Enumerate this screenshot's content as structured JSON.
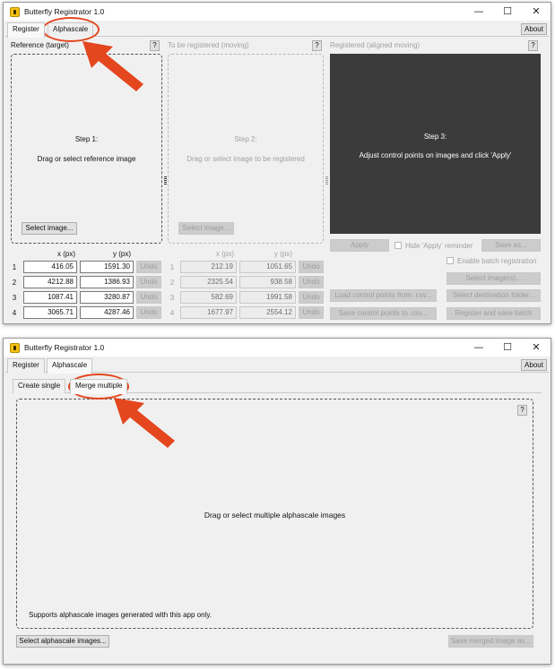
{
  "app": {
    "title": "Butterfly Registrator 1.0"
  },
  "window_controls": {
    "minimize": "—",
    "maximize": "☐",
    "close": "✕"
  },
  "tabs": {
    "register": "Register",
    "alphascale": "Alphascale",
    "about": "About"
  },
  "register": {
    "help": "?",
    "reference": {
      "header": "Reference (target)",
      "step": "Step 1:",
      "instruction": "Drag or select reference image",
      "select_button": "Select image..."
    },
    "moving": {
      "header": "To be registered (moving)",
      "step": "Step 2:",
      "instruction": "Drag or select image to be registered",
      "select_button": "Select image..."
    },
    "registered": {
      "header": "Registered (aligned moving)",
      "step": "Step 3:",
      "instruction": "Adjust control points on images and click 'Apply'"
    },
    "col_x": "x (px)",
    "col_y": "y (px)",
    "undo_label": "Undo",
    "ref_points": [
      {
        "n": "1",
        "x": "416.05",
        "y": "1591.30"
      },
      {
        "n": "2",
        "x": "4212.88",
        "y": "1386.93"
      },
      {
        "n": "3",
        "x": "1087.41",
        "y": "3280.87"
      },
      {
        "n": "4",
        "x": "3065.71",
        "y": "4287.46"
      }
    ],
    "mov_points": [
      {
        "n": "1",
        "x": "212.19",
        "y": "1051.65"
      },
      {
        "n": "2",
        "x": "2325.54",
        "y": "938.58"
      },
      {
        "n": "3",
        "x": "582.69",
        "y": "1991.58"
      },
      {
        "n": "4",
        "x": "1677.97",
        "y": "2554.12"
      }
    ],
    "apply": "Apply",
    "hide_apply": "Hide 'Apply' reminder",
    "save_as": "Save as...",
    "enable_batch": "Enable batch registration",
    "select_images": "Select image(s)...",
    "load_cp": "Load control points from .csv...",
    "select_dest": "Select destination folder...",
    "save_cp": "Save control points to .csv...",
    "register_batch": "Register and save batch"
  },
  "alphascale": {
    "subtabs": {
      "create_single": "Create single",
      "merge_multiple": "Merge multiple"
    },
    "help": "?",
    "drop_text": "Drag or select multiple alphascale images",
    "note": "Supports alphascale images generated with this app only.",
    "select_button": "Select alphascale images...",
    "save_button": "Save merged image as..."
  },
  "colors": {
    "accent_annotation": "#e4461e",
    "dark_panel": "#3b3b3b",
    "window_bg": "#f0f0f0"
  },
  "icons": [
    "butterfly-app-icon",
    "arrow-annotation",
    "highlight-ring",
    "splitter-handle"
  ]
}
